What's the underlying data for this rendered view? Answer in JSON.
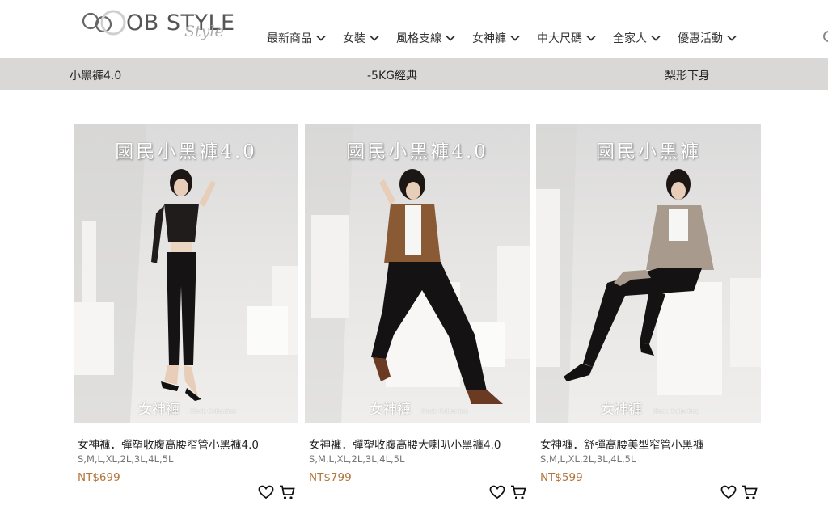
{
  "header": {
    "logo_text": "OB STYLE",
    "logo_script": "Style",
    "nav": [
      {
        "label": "最新商品"
      },
      {
        "label": "女裝"
      },
      {
        "label": "風格支線"
      },
      {
        "label": "女神褲"
      },
      {
        "label": "中大尺碼"
      },
      {
        "label": "全家人"
      },
      {
        "label": "優惠活動"
      }
    ]
  },
  "subbar": {
    "items": [
      {
        "label": "小黑褲4.0"
      },
      {
        "label": "-5KG經典"
      },
      {
        "label": "梨形下身"
      }
    ]
  },
  "products": [
    {
      "image_headline": "國民小黑褲4.0",
      "image_watermark": "女神褲",
      "image_watermark_sub": "Slack Collection",
      "title": "女神褲．彈塑收腹高腰窄管小黑褲4.0",
      "sizes": "S,M,L,XL,2L,3L,4L,5L",
      "price": "NT$699"
    },
    {
      "image_headline": "國民小黑褲4.0",
      "image_watermark": "女神褲",
      "image_watermark_sub": "Slack Collection",
      "title": "女神褲．彈塑收腹高腰大喇叭小黑褲4.0",
      "sizes": "S,M,L,XL,2L,3L,4L,5L",
      "price": "NT$799"
    },
    {
      "image_headline": "國民小黑褲",
      "image_watermark": "女神褲",
      "image_watermark_sub": "Slack Collection",
      "title": "女神褲．舒彈高腰美型窄管小黑褲",
      "sizes": "S,M,L,XL,2L,3L,4L,5L",
      "price": "NT$599"
    }
  ],
  "icons": {
    "nav_chevron": "chevron-down-icon",
    "wishlist": "heart-icon",
    "cart": "cart-icon"
  },
  "colors": {
    "subbar_bg": "#dad8d6",
    "price": "#b4743a",
    "text": "#222222"
  }
}
